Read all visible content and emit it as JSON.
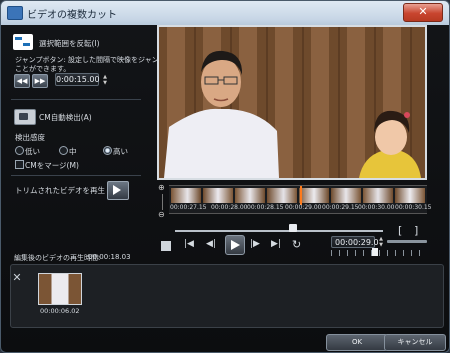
{
  "window": {
    "title": "ビデオの複数カット",
    "close_label": "✕"
  },
  "left": {
    "reverse_label": "選択範囲を反転(I)",
    "jump_desc_line1": "ジャンプボタン: 設定した間隔で映像をジャンプさせる",
    "jump_desc_line2": "ことができます。",
    "jump_back_icon": "rewind-icon",
    "jump_fwd_icon": "fast-forward-icon",
    "jump_interval": "0:00:15.00",
    "cm_detect_label": "CM自動検出(A)",
    "sensitivity_label": "検出感度",
    "sensitivity_options": [
      "低い",
      "中",
      "高い"
    ],
    "sensitivity_selected": "高い",
    "cm_merge_label": "CMをマージ(M)",
    "trim_play_label": "トリムされたビデオを再生",
    "trim_duration_label": "編集後のビデオの再生時間:",
    "trim_duration_value": "00:00:18.03"
  },
  "timeline": {
    "timecodes": [
      "00:00:27.15",
      "00:00:28.00",
      "00:00:28.15",
      "00:00:29.00",
      "00:00:29.15",
      "00:00:30.00",
      "00:00:30.15"
    ],
    "current_time": "00:00:29.0",
    "bracket_in": "[",
    "bracket_out": "]"
  },
  "clip": {
    "time": "00:00:06.02"
  },
  "buttons": {
    "ok": "OK",
    "cancel": "キャンセル"
  },
  "colors": {
    "playhead": "#ff7a1a",
    "accent": "#d7dde3"
  }
}
